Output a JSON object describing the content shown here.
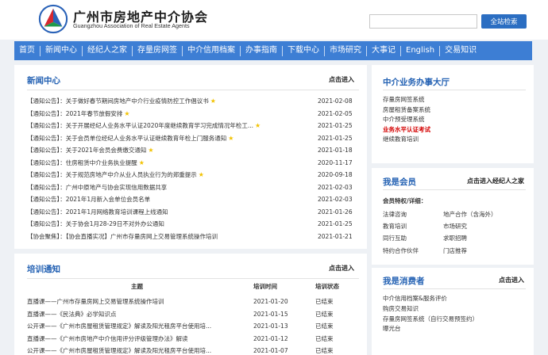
{
  "header": {
    "site_name_cn": "广州市房地产中介协会",
    "site_name_en": "Guangzhou Association of Real Estate Agents",
    "search_placeholder": "",
    "search_button": "全站检索"
  },
  "nav": [
    "首页",
    "新闻中心",
    "经纪人之家",
    "存量房网签",
    "中介信用档案",
    "办事指南",
    "下载中心",
    "市场研究",
    "大事记",
    "English",
    "交易知识"
  ],
  "news": {
    "title": "新闻中心",
    "more": "点击进入",
    "items": [
      {
        "title": "【通知公告】：关于做好春节期间房地产中介行业疫情防控工作倡议书",
        "date": "2021-02-08",
        "star": true
      },
      {
        "title": "【通知公告】：2021年春节放假安排",
        "date": "2021-02-05",
        "star": true
      },
      {
        "title": "【通知公告】：关于开展经纪人业务水平认证2020年度继续教育学习完成情况年检工...",
        "date": "2021-01-25",
        "star": true
      },
      {
        "title": "【通知公告】：关于会员单位经纪人业务水平认证继续教育年检上门服务通知",
        "date": "2021-01-25",
        "star": true
      },
      {
        "title": "【通知公告】：关于2021年会员会费缴交通知",
        "date": "2021-01-18",
        "star": true
      },
      {
        "title": "【通知公告】：住房租赁中介业务执业提醒",
        "date": "2020-11-17",
        "star": true
      },
      {
        "title": "【通知公告】：关于规范房地产中介从业人员执业行为的郑重提示",
        "date": "2020-09-18",
        "star": true
      },
      {
        "title": "【通知公告】：广州中原地产与协会实现信用数据共享",
        "date": "2021-02-03",
        "star": false
      },
      {
        "title": "【通知公告】：2021年1月新入会单位会员名单",
        "date": "2021-02-03",
        "star": false
      },
      {
        "title": "【通知公告】：2021年1月网络教育培训课程上线通知",
        "date": "2021-01-26",
        "star": false
      },
      {
        "title": "【通知公告】：关于协会1月28-29日不对外办公通知",
        "date": "2021-01-25",
        "star": false
      },
      {
        "title": "【协会聚焦】：【协会直播实况】广州市存量房网上交易管理系统操作培训",
        "date": "2021-01-21",
        "star": false
      }
    ]
  },
  "training": {
    "title": "培训通知",
    "more": "点击进入",
    "headers": [
      "主题",
      "培训时间",
      "培训状态"
    ],
    "rows": [
      {
        "topic": "直播课——广州市存量房网上交易管理系统操作培训",
        "time": "2021-01-20",
        "status": "已结束"
      },
      {
        "topic": "直播课——《民法典》必学知识点",
        "time": "2021-01-15",
        "status": "已结束"
      },
      {
        "topic": "公开课——《广州市房屋租赁管理规定》解读及阳光租房平台使用培...",
        "time": "2021-01-13",
        "status": "已结束"
      },
      {
        "topic": "直播课——《广州市房地产中介信用评分评级管理办法》解读",
        "time": "2021-01-12",
        "status": "已结束"
      },
      {
        "topic": "公开课——《广州市房屋租赁管理规定》解读及阳光租房平台使用培...",
        "time": "2021-01-07",
        "status": "已结束"
      }
    ]
  },
  "hall": {
    "title": "中介业务办事大厅",
    "items": [
      {
        "label": "存量房网签系统",
        "highlight": false
      },
      {
        "label": "房屋租赁备案系统",
        "highlight": false
      },
      {
        "label": "中介预受理系统",
        "highlight": false
      },
      {
        "label": "业务水平认证考试",
        "highlight": true
      },
      {
        "label": "继续教育培训",
        "highlight": false
      }
    ]
  },
  "member": {
    "title": "我是会员",
    "more": "点击进入经纪人之家",
    "subtitle": "会员特权/详细：",
    "items": [
      "法律咨询",
      "地产合作（含海外）",
      "教育培训",
      "市场研究",
      "同行互助",
      "求职招聘",
      "特约合作伙伴",
      "门店推荐"
    ]
  },
  "consumer": {
    "title": "我是消费者",
    "more": "点击进入",
    "items": [
      "中介信用档案&服务评价",
      "购房交易知识",
      "存量房网签系统（自行交易预签约）",
      "曝光台"
    ]
  },
  "colors": {
    "nav_bg": "#3d7ed4",
    "title_blue": "#2361b3",
    "button_blue": "#2b6ec2",
    "highlight_red": "#d40000",
    "star_yellow": "#f2c200"
  }
}
